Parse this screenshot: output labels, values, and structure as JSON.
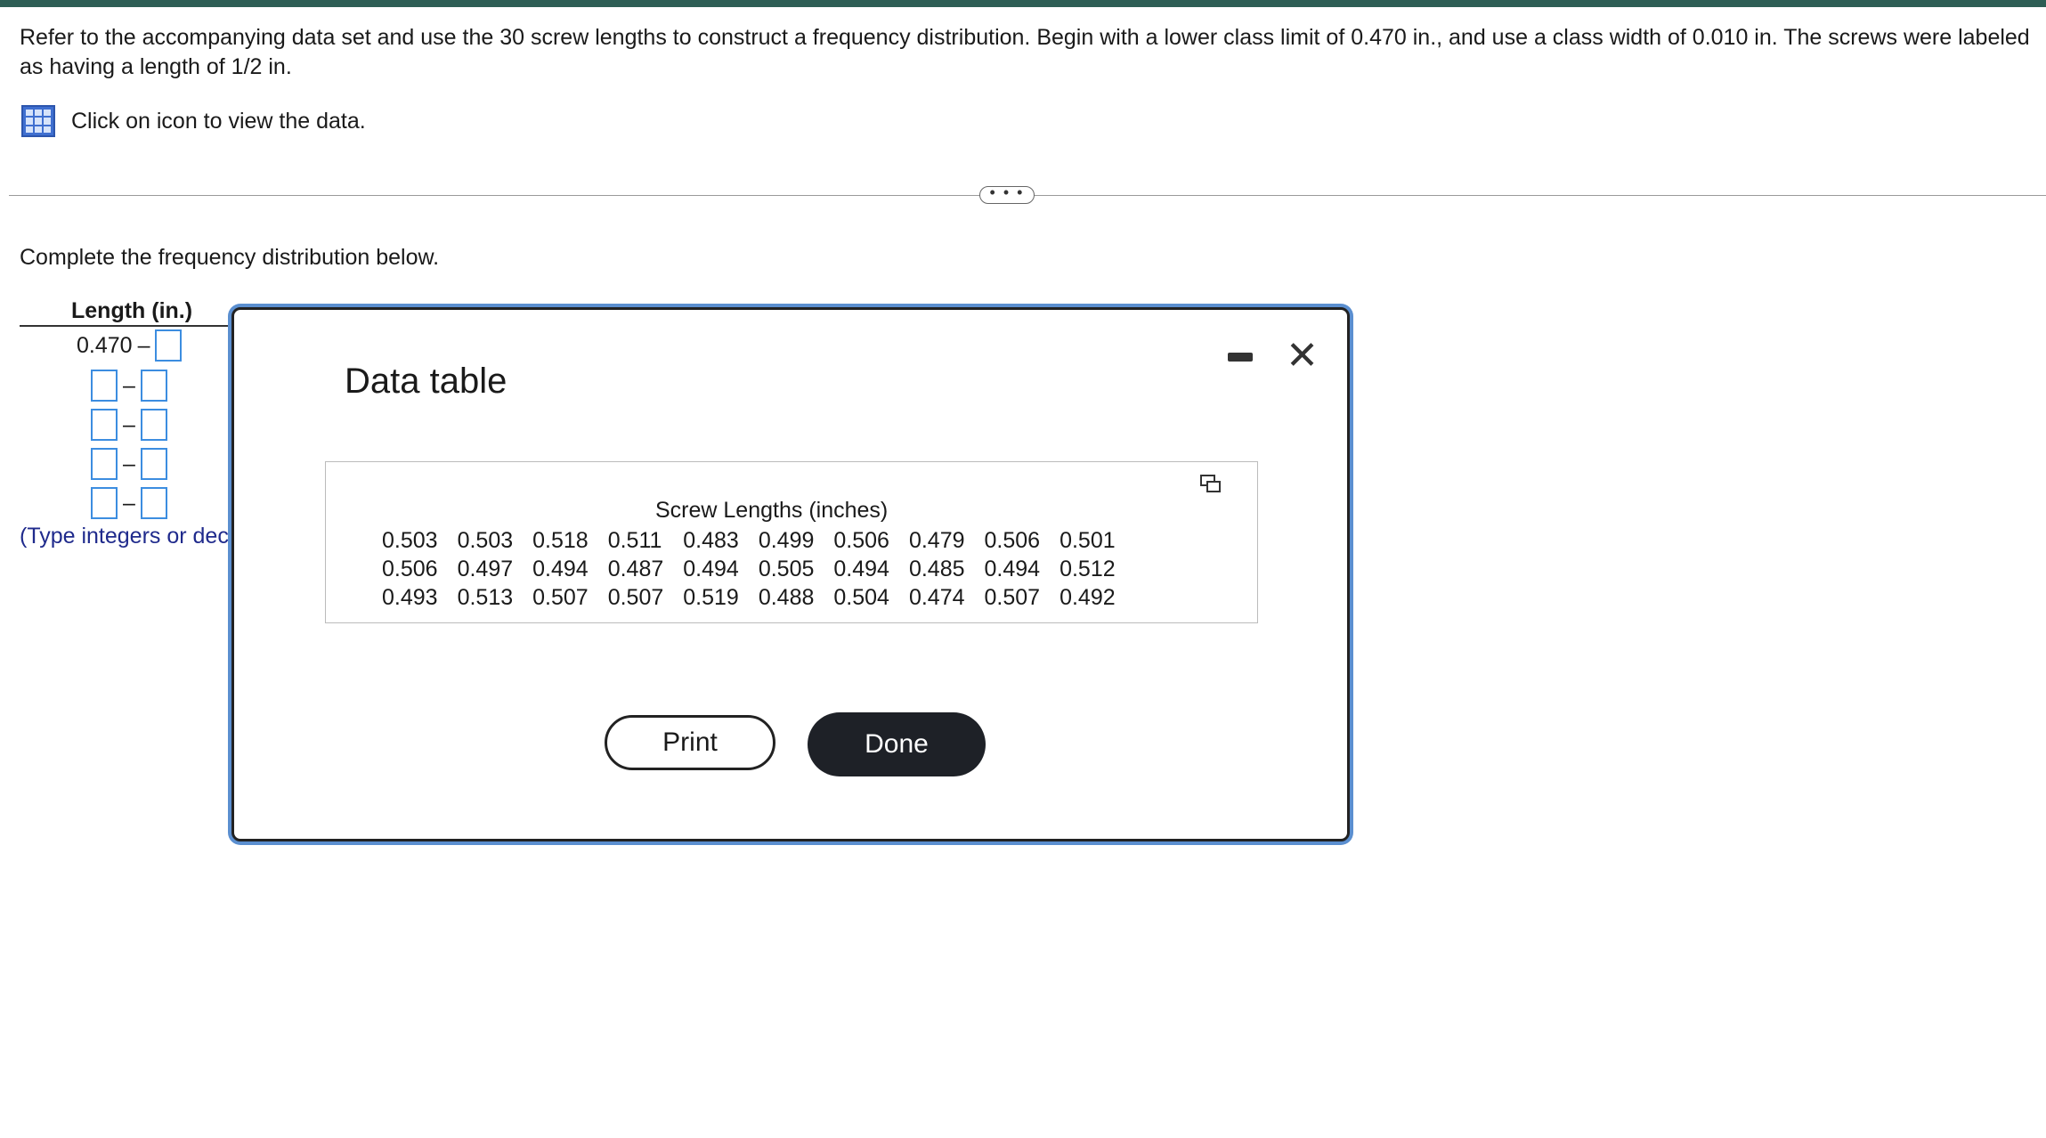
{
  "question": {
    "text": "Refer to the accompanying data set and use the 30 screw lengths to construct a frequency distribution. Begin with a lower class limit of 0.470 in., and use a class width of 0.010 in. The screws were labeled as having a length of 1/2 in.",
    "view_data_label": "Click on icon to view the data."
  },
  "more_button_label": "• • •",
  "instruction": "Complete the frequency distribution below.",
  "freq_table": {
    "header": "Length (in.)",
    "first_lower": "0.470",
    "dash": "–",
    "hint": "(Type integers or decimals.)"
  },
  "dialog": {
    "title": "Data table",
    "caption": "Screw Lengths (inches)",
    "rows": [
      [
        "0.503",
        "0.503",
        "0.518",
        "0.511",
        "0.483",
        "0.499",
        "0.506",
        "0.479",
        "0.506",
        "0.501"
      ],
      [
        "0.506",
        "0.497",
        "0.494",
        "0.487",
        "0.494",
        "0.505",
        "0.494",
        "0.485",
        "0.494",
        "0.512"
      ],
      [
        "0.493",
        "0.513",
        "0.507",
        "0.507",
        "0.519",
        "0.488",
        "0.504",
        "0.474",
        "0.507",
        "0.492"
      ]
    ],
    "print_label": "Print",
    "done_label": "Done",
    "close_glyph": "✕"
  },
  "icons": [
    "grid-icon",
    "copy-icon",
    "minimize-icon",
    "close-icon"
  ]
}
